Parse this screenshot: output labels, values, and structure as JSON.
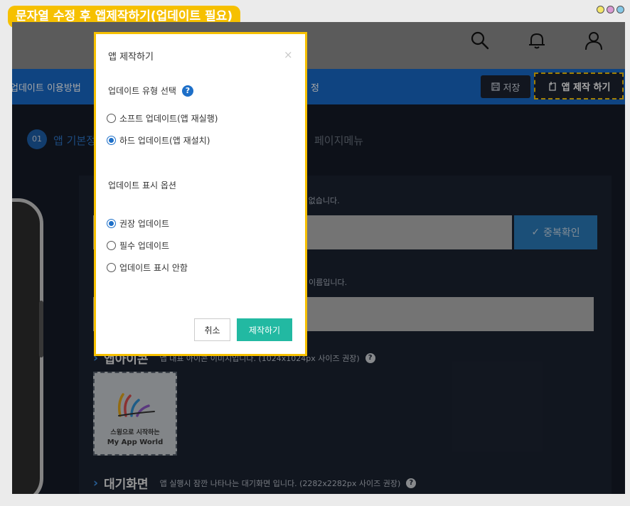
{
  "caption": "문자열 수정 후 앱제작하기(업데이트 필요)",
  "window_dots": [
    "yellow-dot",
    "pink-dot",
    "blue-dot"
  ],
  "header": {
    "icons": [
      "search-icon",
      "bell-icon",
      "user-icon"
    ]
  },
  "nav": {
    "left_text": "업데이트 이용방법",
    "right_fragment": "정",
    "save_label": "저장",
    "make_label": "앱 제작 하기"
  },
  "steps": {
    "number": "01",
    "label": "앱 기본정",
    "label2": "페이지메뉴"
  },
  "form": {
    "hint1": "수 없습니다.",
    "duplicate_label": "중복확인",
    "hint2": "이름입니다.",
    "icon_section": {
      "title": "앱아이콘",
      "desc": "앱 대표 아이콘 이미지입니다. (1024x1024px 사이즈 권장)",
      "preview_line1": "스윙으로 시작하는",
      "preview_line2": "My App World"
    },
    "splash_section": {
      "title": "대기화면",
      "desc": "앱 실행시 잠깐 나타나는 대기화면 입니다. (2282x2282px 사이즈 권장)"
    }
  },
  "modal": {
    "title": "앱 제작하기",
    "close": "×",
    "section1_title": "업데이트 유형 선택",
    "update_types": [
      {
        "label": "소프트 업데이트(앱 재실행)",
        "selected": false
      },
      {
        "label": "하드 업데이트(앱 재설치)",
        "selected": true
      }
    ],
    "section2_title": "업데이트 표시 옵션",
    "display_options": [
      {
        "label": "권장 업데이트",
        "selected": true
      },
      {
        "label": "필수 업데이트",
        "selected": false
      },
      {
        "label": "업데이트 표시 안함",
        "selected": false
      }
    ],
    "cancel_label": "취소",
    "confirm_label": "제작하기"
  },
  "colors": {
    "accent_yellow": "#f6c000",
    "nav_blue": "#1769c6",
    "confirm_teal": "#22b9a2",
    "radio_blue": "#1d6fc8"
  }
}
